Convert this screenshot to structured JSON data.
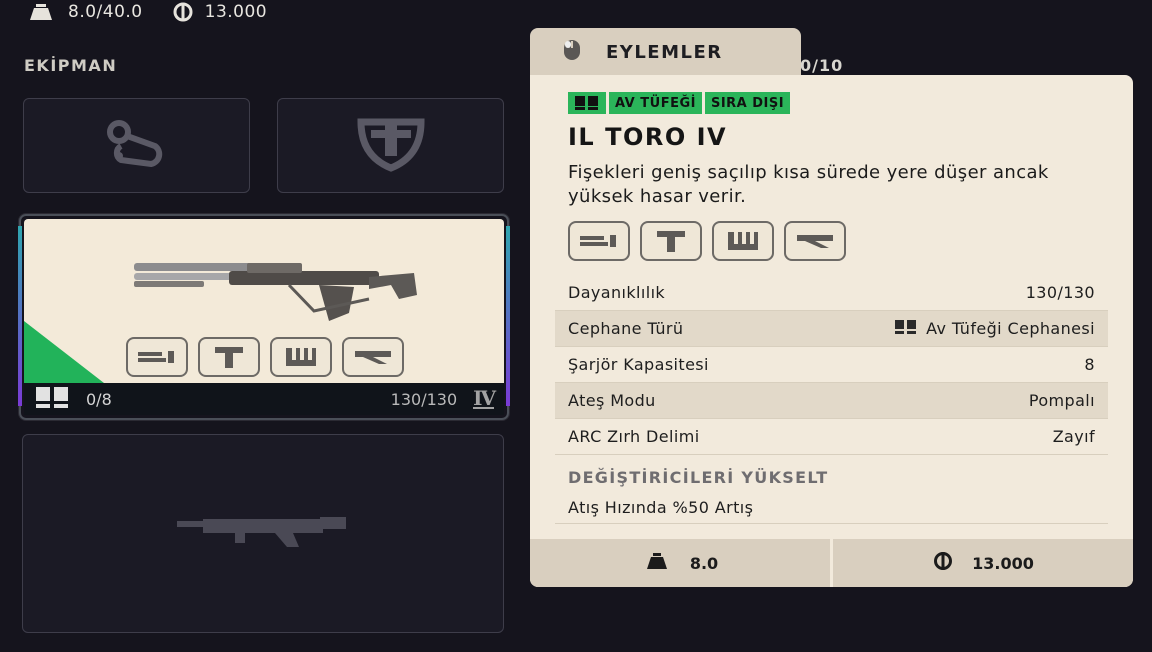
{
  "topbar": {
    "weight": "8.0/40.0",
    "currency": "13.000",
    "weight_icon": "weight-icon",
    "currency_icon": "coin-icon"
  },
  "equipment": {
    "title": "EKİPMAN"
  },
  "slots": [
    {
      "icon": "augment-icon"
    },
    {
      "icon": "shield-icon"
    },
    {
      "icon": "weapon-silhouette-icon"
    }
  ],
  "weapon_card": {
    "ammo_count": "0/8",
    "durability": "130/130",
    "tier": "IV",
    "rarity_color": "#22b35a"
  },
  "side": {
    "partial_text": "0/10"
  },
  "actions_tab": {
    "label": "EYLEMLER",
    "icon": "mouse-icon"
  },
  "details": {
    "tags": [
      "AV TÜFEĞİ",
      "SIRA DIŞI"
    ],
    "name": "IL TORO IV",
    "description": "Fişekleri geniş saçılıp kısa sürede yere düşer ancak yüksek hasar verir.",
    "stats": [
      {
        "label": "Dayanıklılık",
        "value": "130/130"
      },
      {
        "label": "Cephane Türü",
        "value": "Av Tüfeği Cephanesi"
      },
      {
        "label": "Şarjör Kapasitesi",
        "value": "8"
      },
      {
        "label": "Ateş Modu",
        "value": "Pompalı"
      },
      {
        "label": "ARC Zırh Delimi",
        "value": "Zayıf"
      }
    ],
    "upgrade_title": "DEĞİŞTİRİCİLERİ YÜKSELT",
    "upgrade_text": "Atış Hızında %50 Artış",
    "weight": "8.0",
    "price": "13.000"
  },
  "mods": [
    "muzzle-mod-icon",
    "underbarrel-mod-icon",
    "magazine-mod-icon",
    "stock-mod-icon"
  ],
  "colors": {
    "accent_green": "#2bb55a",
    "panel_bg": "#f2eadc",
    "tab_bg": "#d9cfbf",
    "page_bg": "#15141d"
  }
}
